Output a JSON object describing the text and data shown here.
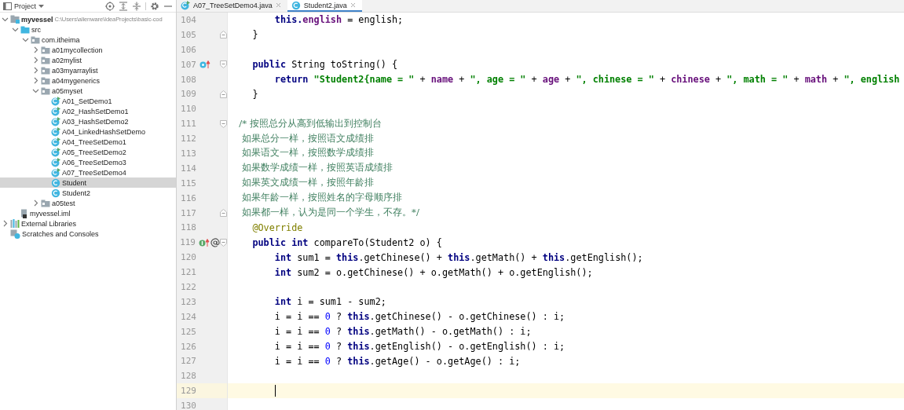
{
  "project_panel": {
    "title": "Project",
    "tree": [
      {
        "label": "myvessel",
        "path": "C:\\Users\\alienware\\IdeaProjects\\basic-cod",
        "kind": "module",
        "expanded": true,
        "selected": false,
        "children": [
          {
            "label": "src",
            "kind": "source",
            "expanded": true,
            "selected": false,
            "children": [
              {
                "label": "com.itheima",
                "kind": "package",
                "expanded": true,
                "selected": false,
                "children": [
                  {
                    "label": "a01mycollection",
                    "kind": "package",
                    "expanded": false,
                    "selected": false
                  },
                  {
                    "label": "a02mylist",
                    "kind": "package",
                    "expanded": false,
                    "selected": false
                  },
                  {
                    "label": "a03myarraylist",
                    "kind": "package",
                    "expanded": false,
                    "selected": false
                  },
                  {
                    "label": "a04mygenerics",
                    "kind": "package",
                    "expanded": false,
                    "selected": false
                  },
                  {
                    "label": "a05myset",
                    "kind": "package",
                    "expanded": true,
                    "selected": false,
                    "children": [
                      {
                        "label": "A01_SetDemo1",
                        "kind": "main-class",
                        "selected": false
                      },
                      {
                        "label": "A02_HashSetDemo1",
                        "kind": "main-class",
                        "selected": false
                      },
                      {
                        "label": "A03_HashSetDemo2",
                        "kind": "main-class",
                        "selected": false
                      },
                      {
                        "label": "A04_LinkedHashSetDemo",
                        "kind": "main-class",
                        "selected": false
                      },
                      {
                        "label": "A04_TreeSetDemo1",
                        "kind": "main-class",
                        "selected": false
                      },
                      {
                        "label": "A05_TreeSetDemo2",
                        "kind": "main-class",
                        "selected": false
                      },
                      {
                        "label": "A06_TreeSetDemo3",
                        "kind": "main-class",
                        "selected": false
                      },
                      {
                        "label": "A07_TreeSetDemo4",
                        "kind": "main-class",
                        "selected": false
                      },
                      {
                        "label": "Student",
                        "kind": "class",
                        "selected": true
                      },
                      {
                        "label": "Student2",
                        "kind": "class",
                        "selected": false
                      }
                    ]
                  },
                  {
                    "label": "a05test",
                    "kind": "package",
                    "expanded": false,
                    "selected": false
                  }
                ]
              }
            ]
          },
          {
            "label": "myvessel.iml",
            "kind": "file",
            "selected": false
          }
        ]
      },
      {
        "label": "External Libraries",
        "kind": "library",
        "expanded": false,
        "selected": false
      },
      {
        "label": "Scratches and Consoles",
        "kind": "scratches",
        "selected": false
      }
    ]
  },
  "tabs": [
    {
      "label": "A07_TreeSetDemo4.java",
      "kind": "main-class",
      "selected": false
    },
    {
      "label": "Student2.java",
      "kind": "class",
      "selected": true
    }
  ],
  "editor": {
    "lines": [
      {
        "number": "104",
        "tokens": [
          {
            "kind": "keyword",
            "text": "        this."
          },
          {
            "kind": "field",
            "text": "english"
          },
          {
            "kind": "plain",
            "text": " = english;"
          }
        ]
      },
      {
        "number": "105",
        "gutter": [
          {
            "kind": "fold-end"
          }
        ],
        "tokens": [
          {
            "kind": "plain",
            "text": "    }"
          }
        ]
      },
      {
        "number": "106"
      },
      {
        "number": "107",
        "gutter": [
          {
            "kind": "override"
          },
          {
            "kind": "fold-start"
          }
        ],
        "tokens": [
          {
            "kind": "keyword",
            "text": "    public"
          },
          {
            "kind": "plain",
            "text": " String toString() {"
          }
        ]
      },
      {
        "number": "108",
        "tokens": [
          {
            "kind": "keyword",
            "text": "        return "
          },
          {
            "kind": "string",
            "text": "\"Student2{name = \""
          },
          {
            "kind": "plain",
            "text": " + "
          },
          {
            "kind": "field",
            "text": "name"
          },
          {
            "kind": "plain",
            "text": " + "
          },
          {
            "kind": "string",
            "text": "\", age = \""
          },
          {
            "kind": "plain",
            "text": " + "
          },
          {
            "kind": "field",
            "text": "age"
          },
          {
            "kind": "plain",
            "text": " + "
          },
          {
            "kind": "string",
            "text": "\", chinese = \""
          },
          {
            "kind": "plain",
            "text": " + "
          },
          {
            "kind": "field",
            "text": "chinese"
          },
          {
            "kind": "plain",
            "text": " + "
          },
          {
            "kind": "string",
            "text": "\", math = \""
          },
          {
            "kind": "plain",
            "text": " + "
          },
          {
            "kind": "field",
            "text": "math"
          },
          {
            "kind": "plain",
            "text": " + "
          },
          {
            "kind": "string",
            "text": "\", english"
          }
        ]
      },
      {
        "number": "109",
        "gutter": [
          {
            "kind": "fold-end"
          }
        ],
        "tokens": [
          {
            "kind": "plain",
            "text": "    }"
          }
        ]
      },
      {
        "number": "110"
      },
      {
        "number": "111",
        "gutter": [
          {
            "kind": "fold-start"
          }
        ],
        "tokens": [
          {
            "kind": "comment",
            "text": "   /* 按照总分从高到低输出到控制台"
          }
        ]
      },
      {
        "number": "112",
        "tokens": [
          {
            "kind": "comment",
            "text": "    如果总分一样，按照语文成绩排"
          }
        ]
      },
      {
        "number": "113",
        "tokens": [
          {
            "kind": "comment",
            "text": "    如果语文一样，按照数学成绩排"
          }
        ]
      },
      {
        "number": "114",
        "tokens": [
          {
            "kind": "comment",
            "text": "    如果数学成绩一样，按照英语成绩排"
          }
        ]
      },
      {
        "number": "115",
        "tokens": [
          {
            "kind": "comment",
            "text": "    如果英文成绩一样，按照年龄排"
          }
        ]
      },
      {
        "number": "116",
        "tokens": [
          {
            "kind": "comment",
            "text": "    如果年龄一样，按照姓名的字母顺序排"
          }
        ]
      },
      {
        "number": "117",
        "gutter": [
          {
            "kind": "fold-end"
          }
        ],
        "tokens": [
          {
            "kind": "comment",
            "text": "    如果都一样，认为是同一个学生，不存。*/"
          }
        ]
      },
      {
        "number": "118",
        "tokens": [
          {
            "kind": "annotation",
            "text": "    @Override"
          }
        ]
      },
      {
        "number": "119",
        "gutter": [
          {
            "kind": "implement"
          },
          {
            "kind": "annotation"
          },
          {
            "kind": "fold-start"
          }
        ],
        "tokens": [
          {
            "kind": "keyword",
            "text": "    public int"
          },
          {
            "kind": "plain",
            "text": " compareTo(Student2 o) {"
          }
        ]
      },
      {
        "number": "120",
        "tokens": [
          {
            "kind": "keyword",
            "text": "        int"
          },
          {
            "kind": "plain",
            "text": " sum1 = "
          },
          {
            "kind": "keyword",
            "text": "this"
          },
          {
            "kind": "plain",
            "text": ".getChinese() + "
          },
          {
            "kind": "keyword",
            "text": "this"
          },
          {
            "kind": "plain",
            "text": ".getMath() + "
          },
          {
            "kind": "keyword",
            "text": "this"
          },
          {
            "kind": "plain",
            "text": ".getEnglish();"
          }
        ]
      },
      {
        "number": "121",
        "tokens": [
          {
            "kind": "keyword",
            "text": "        int"
          },
          {
            "kind": "plain",
            "text": " sum2 = o.getChinese() + o.getMath() + o.getEnglish();"
          }
        ]
      },
      {
        "number": "122"
      },
      {
        "number": "123",
        "tokens": [
          {
            "kind": "keyword",
            "text": "        int"
          },
          {
            "kind": "plain",
            "text": " i = sum1 - sum2;"
          }
        ]
      },
      {
        "number": "124",
        "tokens": [
          {
            "kind": "plain",
            "text": "        i = i == "
          },
          {
            "kind": "number",
            "text": "0"
          },
          {
            "kind": "plain",
            "text": " ? "
          },
          {
            "kind": "keyword",
            "text": "this"
          },
          {
            "kind": "plain",
            "text": ".getChinese() - o.getChinese() : i;"
          }
        ]
      },
      {
        "number": "125",
        "tokens": [
          {
            "kind": "plain",
            "text": "        i = i == "
          },
          {
            "kind": "number",
            "text": "0"
          },
          {
            "kind": "plain",
            "text": " ? "
          },
          {
            "kind": "keyword",
            "text": "this"
          },
          {
            "kind": "plain",
            "text": ".getMath() - o.getMath() : i;"
          }
        ]
      },
      {
        "number": "126",
        "tokens": [
          {
            "kind": "plain",
            "text": "        i = i == "
          },
          {
            "kind": "number",
            "text": "0"
          },
          {
            "kind": "plain",
            "text": " ? "
          },
          {
            "kind": "keyword",
            "text": "this"
          },
          {
            "kind": "plain",
            "text": ".getEnglish() - o.getEnglish() : i;"
          }
        ]
      },
      {
        "number": "127",
        "tokens": [
          {
            "kind": "plain",
            "text": "        i = i == "
          },
          {
            "kind": "number",
            "text": "0"
          },
          {
            "kind": "plain",
            "text": " ? "
          },
          {
            "kind": "keyword",
            "text": "this"
          },
          {
            "kind": "plain",
            "text": ".getAge() - o.getAge() : i;"
          }
        ]
      },
      {
        "number": "128"
      },
      {
        "number": "129",
        "current": true
      },
      {
        "number": "130"
      }
    ]
  }
}
